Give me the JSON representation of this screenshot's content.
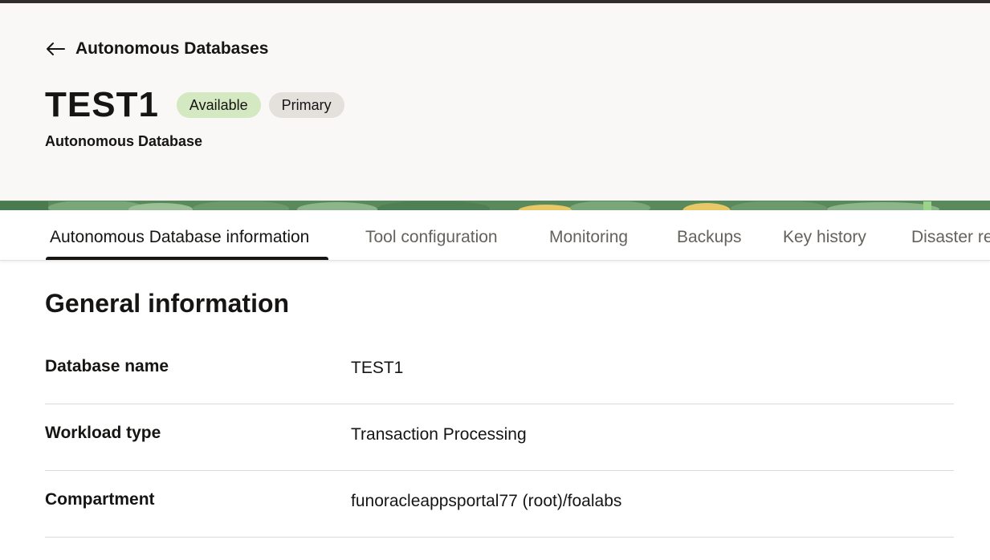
{
  "header": {
    "back_label": "Autonomous Databases",
    "title": "TEST1",
    "badges": [
      {
        "label": "Available",
        "color": "#d4e8c2"
      },
      {
        "label": "Primary",
        "color": "#e4e1dd"
      }
    ],
    "subtitle": "Autonomous Database"
  },
  "tabs": [
    {
      "label": "Autonomous Database information",
      "active": true
    },
    {
      "label": "Tool configuration",
      "active": false
    },
    {
      "label": "Monitoring",
      "active": false
    },
    {
      "label": "Backups",
      "active": false
    },
    {
      "label": "Key history",
      "active": false
    },
    {
      "label": "Disaster re",
      "active": false
    }
  ],
  "main": {
    "section_title": "General information",
    "rows": [
      {
        "label": "Database name",
        "value": "TEST1"
      },
      {
        "label": "Workload type",
        "value": "Transaction Processing"
      },
      {
        "label": "Compartment",
        "value": "funoracleappsportal77 (root)/foalabs"
      }
    ]
  },
  "colors": {
    "header_bg": "#f9f8f6",
    "banner_green": "#5a8a5c",
    "banner_yellow": "#e8c766"
  }
}
